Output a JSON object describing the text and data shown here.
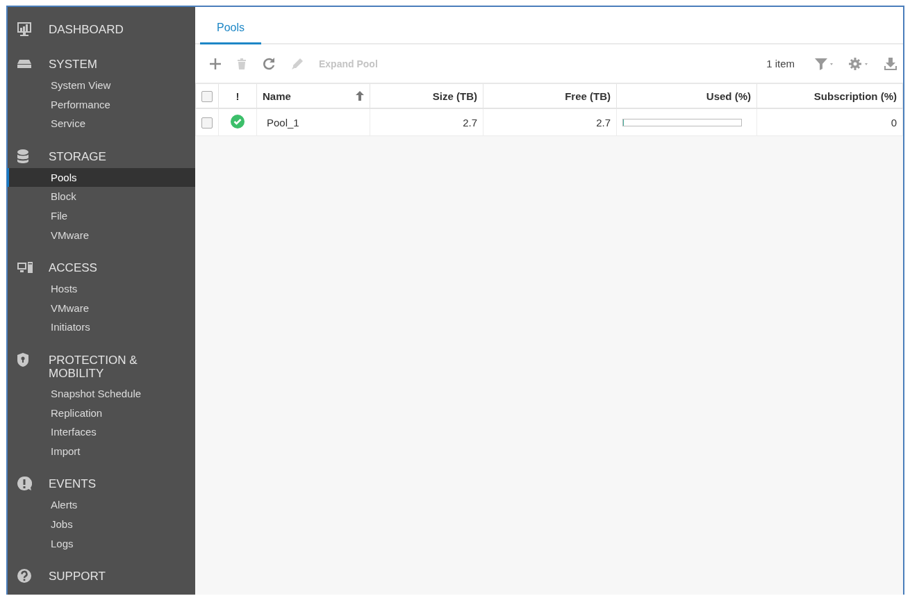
{
  "sidebar": {
    "sections": [
      {
        "kind": "dashboard",
        "title": "DASHBOARD"
      },
      {
        "kind": "system",
        "title": "SYSTEM",
        "items": [
          {
            "label": "System View",
            "selected": false
          },
          {
            "label": "Performance",
            "selected": false
          },
          {
            "label": "Service",
            "selected": false
          }
        ]
      },
      {
        "kind": "storage",
        "title": "STORAGE",
        "items": [
          {
            "label": "Pools",
            "selected": true
          },
          {
            "label": "Block",
            "selected": false
          },
          {
            "label": "File",
            "selected": false
          },
          {
            "label": "VMware",
            "selected": false
          }
        ]
      },
      {
        "kind": "access",
        "title": "ACCESS",
        "items": [
          {
            "label": "Hosts",
            "selected": false
          },
          {
            "label": "VMware",
            "selected": false
          },
          {
            "label": "Initiators",
            "selected": false
          }
        ]
      },
      {
        "kind": "protection",
        "title": "PROTECTION & MOBILITY",
        "items": [
          {
            "label": "Snapshot Schedule",
            "selected": false
          },
          {
            "label": "Replication",
            "selected": false
          },
          {
            "label": "Interfaces",
            "selected": false
          },
          {
            "label": "Import",
            "selected": false
          }
        ]
      },
      {
        "kind": "events",
        "title": "EVENTS",
        "items": [
          {
            "label": "Alerts",
            "selected": false
          },
          {
            "label": "Jobs",
            "selected": false
          },
          {
            "label": "Logs",
            "selected": false
          }
        ]
      },
      {
        "kind": "support",
        "title": "SUPPORT"
      }
    ]
  },
  "tabs": [
    {
      "label": "Pools",
      "selected": true
    }
  ],
  "toolbar": {
    "actions": [
      {
        "kind": "add",
        "disabled": false
      },
      {
        "kind": "delete",
        "disabled": true
      },
      {
        "kind": "refresh",
        "disabled": false
      },
      {
        "kind": "edit",
        "disabled": true
      },
      {
        "kind": "text",
        "label": "Expand Pool",
        "disabled": true
      }
    ],
    "count": "1 item"
  },
  "table": {
    "all_checked": false,
    "columns": [
      {
        "label": "!",
        "sorted": false
      },
      {
        "label": "Name",
        "sorted": true
      },
      {
        "label": "Size (TB)",
        "sorted": false
      },
      {
        "label": "Free (TB)",
        "sorted": false
      },
      {
        "label": "Used (%)",
        "sorted": false
      },
      {
        "label": "Subscription (%)",
        "sorted": false
      }
    ],
    "rows": [
      {
        "checked": false,
        "healthy": true,
        "name": "Pool_1",
        "size": "2.7",
        "free": "2.7",
        "level": 0,
        "subscription": "0"
      }
    ]
  }
}
